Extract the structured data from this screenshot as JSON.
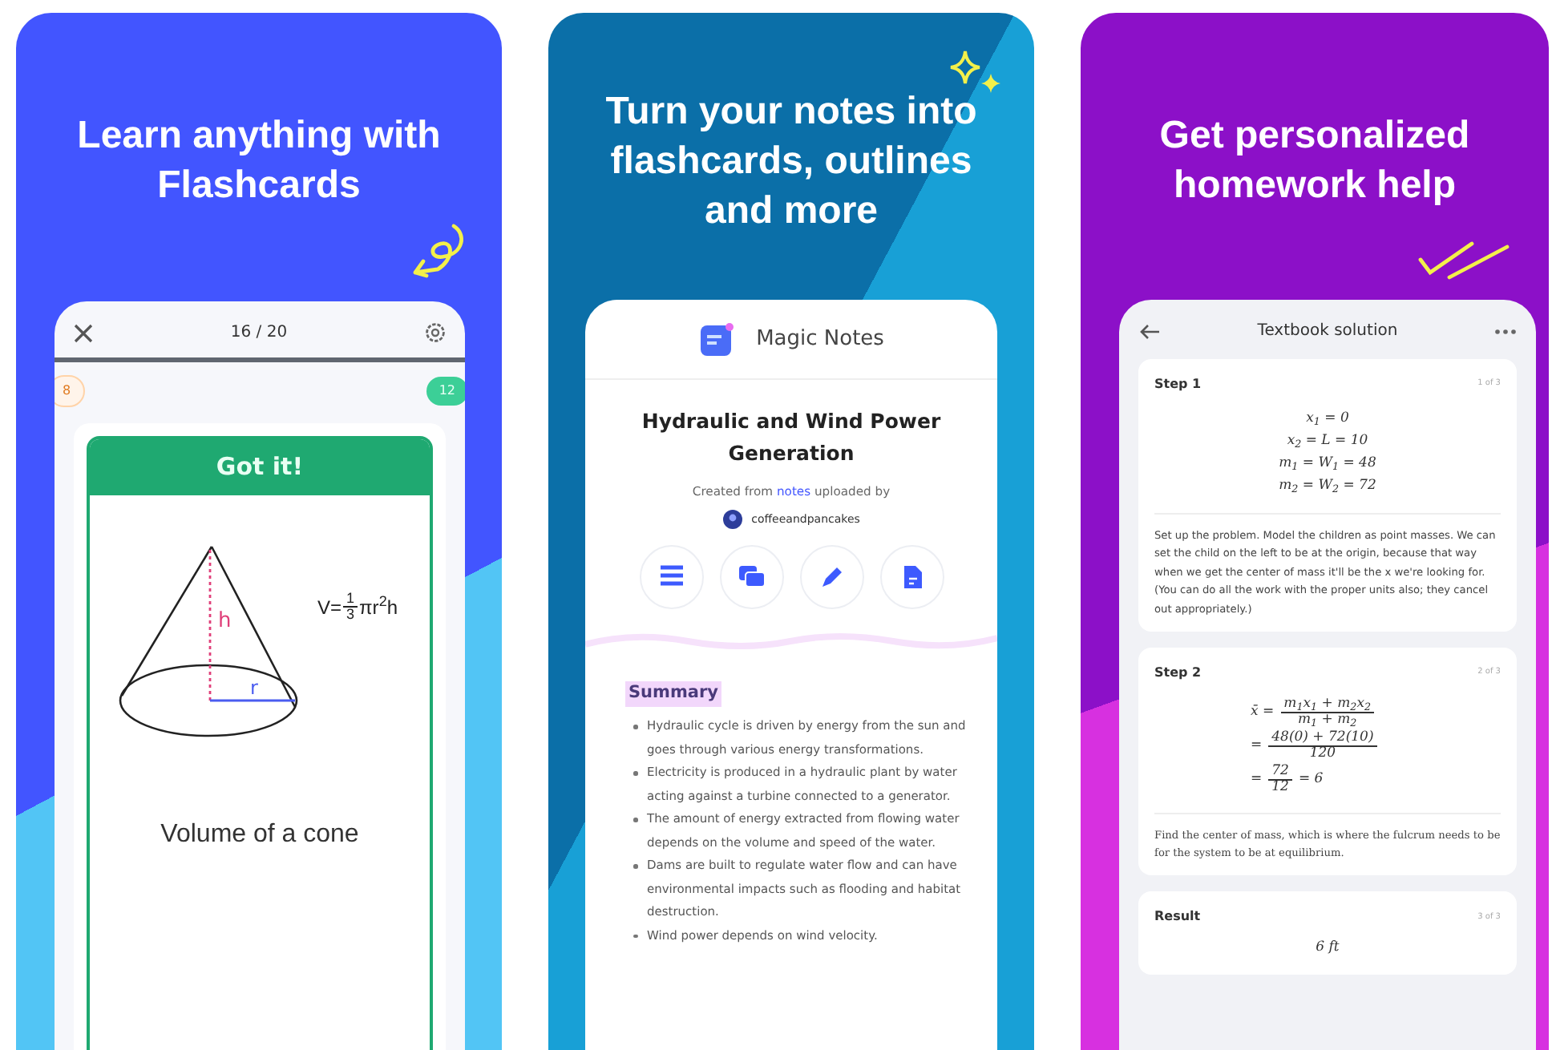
{
  "panels": [
    {
      "kind": "flashcards",
      "headline": "Learn anything with Flashcards",
      "screen": {
        "progress": "16 / 20",
        "left_count": "8",
        "right_count": "12",
        "card": {
          "banner": "Got it!",
          "h_label": "h",
          "r_label": "r",
          "formula_lead": "V=",
          "formula_num": "1",
          "formula_den": "3",
          "formula_tail": "πr$^{2}$h",
          "term": "Volume of a cone"
        }
      }
    },
    {
      "kind": "notes",
      "headline": "Turn your notes into flashcards, outlines and more",
      "screen": {
        "app_title": "Magic Notes",
        "note_title": "Hydraulic and Wind Power Generation",
        "credit_before": "Created from",
        "credit_link": "notes",
        "credit_after": "uploaded by",
        "username": "coffeeandpancakes",
        "section_title": "Summary",
        "bullets": [
          "Hydraulic cycle is driven by energy from the sun and goes through various energy transformations.",
          "Electricity is produced in a hydraulic plant by water acting against a turbine connected to a generator.",
          "The amount of energy extracted from flowing water depends on the volume and speed of the water.",
          "Dams are built to regulate water flow and can have environmental impacts such as flooding and habitat destruction.",
          "Wind power depends on wind velocity."
        ]
      }
    },
    {
      "kind": "solution",
      "headline": "Get personalized homework help",
      "screen": {
        "title": "Textbook solution",
        "steps": [
          {
            "kind": "lines",
            "title": "Step 1",
            "counter": "1 of 3",
            "lines": [
              "x$_{1}$ = 0",
              "x$_{2}$ = L = 10",
              "m$_{1}$ = W$_{1}$ = 48",
              "m$_{2}$ = W$_{2}$ = 72"
            ],
            "text": "Set up the problem. Model the children as point masses. We can set the child on the left to be at the origin, because that way when we get the center of mass it'll be the x we're looking for. (You can do all the work with the proper units also; they cancel out appropriately.)"
          },
          {
            "kind": "fractions",
            "title": "Step 2",
            "counter": "2 of 3",
            "rows": [
              {
                "lead": "x̄ =",
                "num": "m$_{1}$x$_{1}$ + m$_{2}$x$_{2}$",
                "den": "m$_{1}$ + m$_{2}$",
                "tail": ""
              },
              {
                "lead": "=",
                "num": "48(0) + 72(10)",
                "den": "120",
                "tail": ""
              },
              {
                "lead": "=",
                "num": "72",
                "den": "12",
                "tail": "= 6"
              }
            ],
            "text": "Find the center of mass, which is where the fulcrum needs to be for the system to be at equilibrium."
          },
          {
            "kind": "result",
            "title": "Result",
            "counter": "3 of 3",
            "value": "6 ft"
          }
        ]
      }
    }
  ]
}
